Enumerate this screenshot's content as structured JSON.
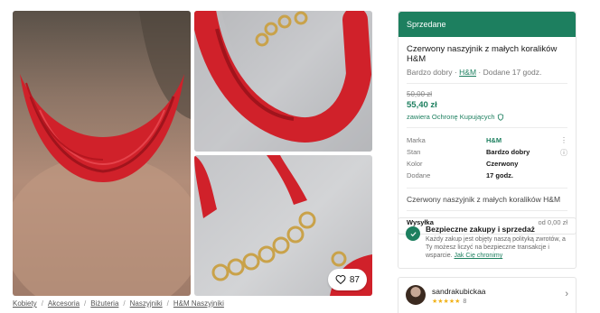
{
  "listing": {
    "status": "Sprzedane",
    "title": "Czerwony naszyjnik z małych koralików H&M",
    "condition": "Bardzo dobry",
    "brand": "H&M",
    "uploaded": "Dodane 17 godz.",
    "price_old": "50,00 zł",
    "price_new": "55,40 zł",
    "protection": "zawiera Ochronę Kupujących",
    "details": [
      {
        "key": "Marka",
        "value": "H&M"
      },
      {
        "key": "Stan",
        "value": "Bardzo dobry"
      },
      {
        "key": "Kolor",
        "value": "Czerwony"
      },
      {
        "key": "Dodane",
        "value": "17 godz."
      }
    ],
    "description": "Czerwony naszyjnik z małych koralików H&M",
    "shipping_label": "Wysyłka",
    "shipping_value": "od 0,00 zł"
  },
  "gallery": {
    "favorites_count": "87"
  },
  "breadcrumb": [
    "Kobiety",
    "Akcesoria",
    "Biżuteria",
    "Naszyjniki",
    "H&M Naszyjniki"
  ],
  "safety": {
    "title": "Bezpieczne zakupy i sprzedaż",
    "body": "Każdy zakup jest objęty naszą polityką zwrotów, a Ty możesz liczyć na bezpieczne transakcje i wsparcie.",
    "link": "Jak Cię chronimy"
  },
  "seller": {
    "name": "sandrakubickaa",
    "stars": "★★★★★",
    "reviews": "8"
  },
  "colors": {
    "accent": "#1d7f5f",
    "sold_banner": "#1d7f5f"
  }
}
